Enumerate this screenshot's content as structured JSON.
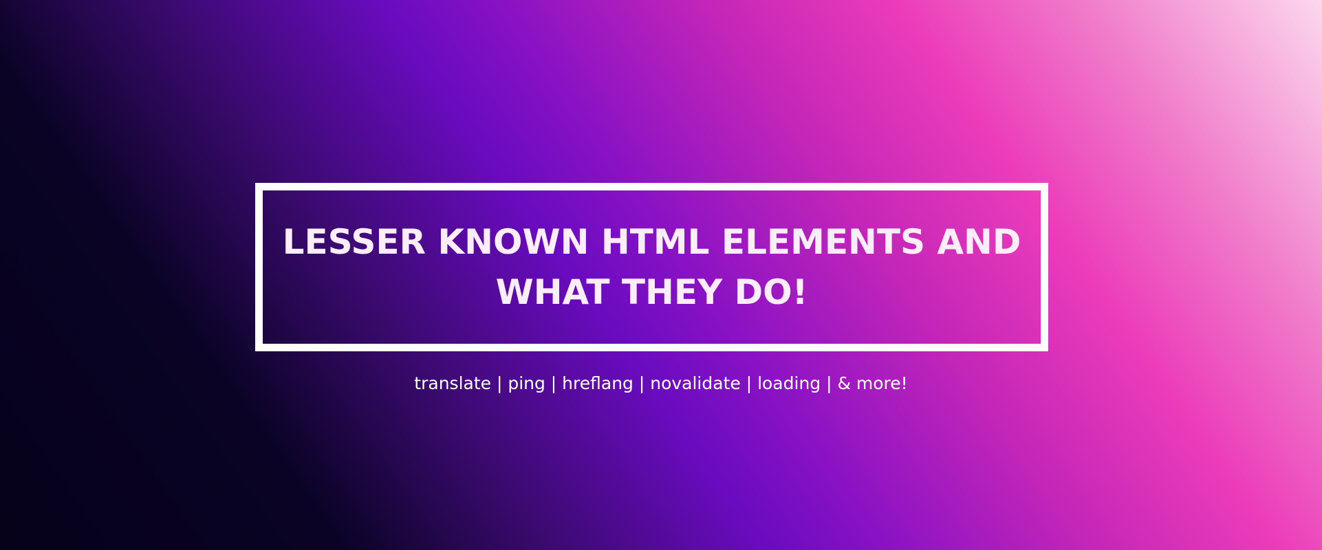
{
  "hero": {
    "title_line1": "LESSER KNOWN HTML ELEMENTS AND",
    "title_line2": "WHAT THEY DO!",
    "subtitle": "translate | ping | hreflang | novalidate | loading | & more!"
  },
  "colors": {
    "gradient_dark": "#05021a",
    "gradient_purple": "#6a0bc0",
    "gradient_pink": "#ec3cba",
    "gradient_light": "#fcd8ee",
    "title_text": "#fbeefa",
    "frame": "#ffffff"
  }
}
